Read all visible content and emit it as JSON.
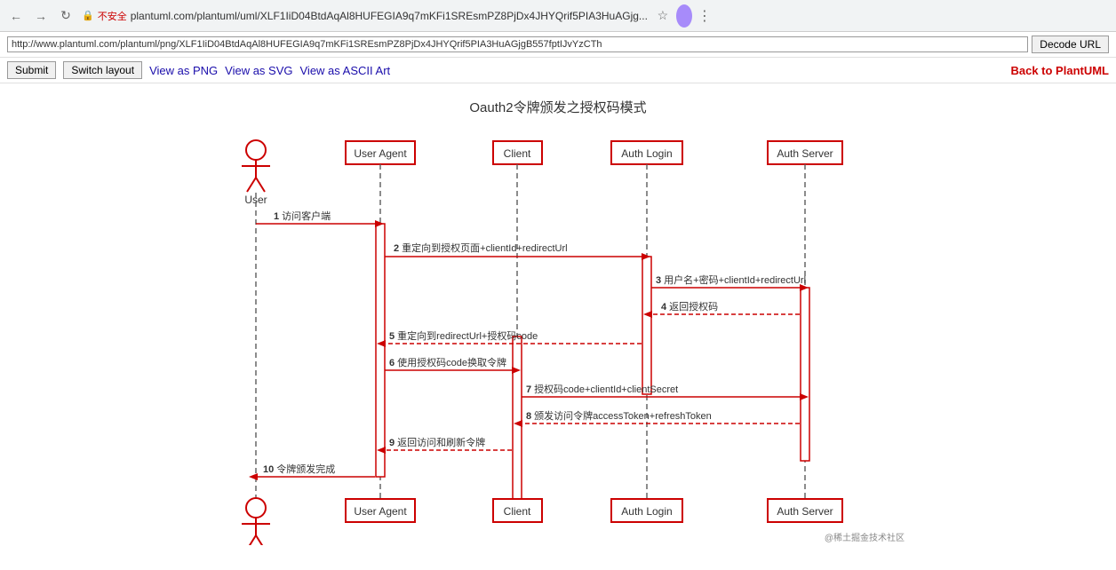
{
  "browser": {
    "back_icon": "←",
    "forward_icon": "→",
    "reload_icon": "↻",
    "security_label": "不安全",
    "url": "plantuml.com/plantuml/uml/XLF1IiD04BtdAqAl8HUFEGIA9q7mKFi1SREsmPZ8PjDx4JHYQrif5PIA3HuAGjg...",
    "decode_url": "http://www.plantuml.com/plantuml/png/XLF1IiD04BtdAqAl8HUFEGIA9q7mKFi1SREsmPZ8PjDx4JHYQrif5PIA3HuAGjgB557fptIJvYzCTh",
    "decode_btn_label": "Decode URL",
    "submit_btn": "Submit",
    "switch_layout_btn": "Switch layout",
    "view_png": "View as PNG",
    "view_svg": "View as SVG",
    "view_ascii": "View as ASCII Art",
    "back_to_plantuml": "Back to PlantUML"
  },
  "diagram": {
    "title": "Oauth2令牌颁发之授权码模式",
    "actors": [
      {
        "id": "user",
        "label": "User"
      },
      {
        "id": "useragent",
        "label": "User Agent"
      },
      {
        "id": "client",
        "label": "Client"
      },
      {
        "id": "authlogin",
        "label": "Auth Login"
      },
      {
        "id": "authserver",
        "label": "Auth Server"
      }
    ],
    "messages": [
      {
        "num": "1",
        "text": "访问客户端",
        "from": "user",
        "to": "useragent",
        "type": "solid"
      },
      {
        "num": "2",
        "text": "重定向到授权页面+clientId+redirectUrl",
        "from": "useragent",
        "to": "authlogin",
        "type": "solid"
      },
      {
        "num": "3",
        "text": "用户名+密码+clientId+redirectUrl",
        "from": "authlogin",
        "to": "authserver",
        "type": "solid"
      },
      {
        "num": "4",
        "text": "返回授权码",
        "from": "authserver",
        "to": "authlogin",
        "type": "dashed"
      },
      {
        "num": "5",
        "text": "重定向到redirectUrl+授权码code",
        "from": "authlogin",
        "to": "useragent",
        "type": "dashed"
      },
      {
        "num": "6",
        "text": "使用授权码code换取令牌",
        "from": "useragent",
        "to": "client",
        "type": "solid"
      },
      {
        "num": "7",
        "text": "授权码code+clientId+clientSecret",
        "from": "client",
        "to": "authserver",
        "type": "solid"
      },
      {
        "num": "8",
        "text": "颁发访问令牌accessToken+refreshToken",
        "from": "authserver",
        "to": "client",
        "type": "dashed"
      },
      {
        "num": "9",
        "text": "返回访问和刷新令牌",
        "from": "client",
        "to": "useragent",
        "type": "dashed"
      },
      {
        "num": "10",
        "text": "令牌颁发完成",
        "from": "useragent",
        "to": "user",
        "type": "solid"
      }
    ],
    "watermark": "@稀土掘金技术社区"
  }
}
